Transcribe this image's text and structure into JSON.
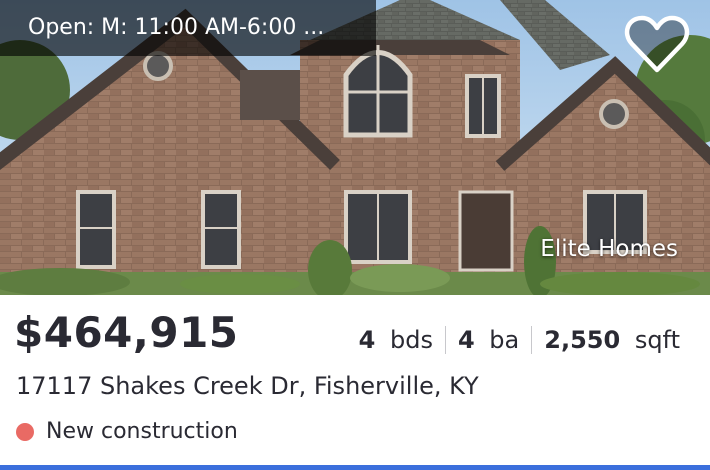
{
  "listing": {
    "open_house": "Open: M: 11:00 AM-6:00 ...",
    "brokerage": "Elite Homes",
    "price": "$464,915",
    "beds_value": "4",
    "beds_unit": "bds",
    "baths_value": "4",
    "baths_unit": "ba",
    "sqft_value": "2,550",
    "sqft_unit": "sqft",
    "address": "17117 Shakes Creek Dr, Fisherville, KY",
    "status": "New construction",
    "favorited": false
  },
  "icons": {
    "favorite": "heart-outline-icon",
    "status": "status-dot-icon"
  },
  "colors": {
    "status_dot": "#e96a64",
    "accent_bar": "#3b6fdc",
    "text": "#2a2a33"
  }
}
